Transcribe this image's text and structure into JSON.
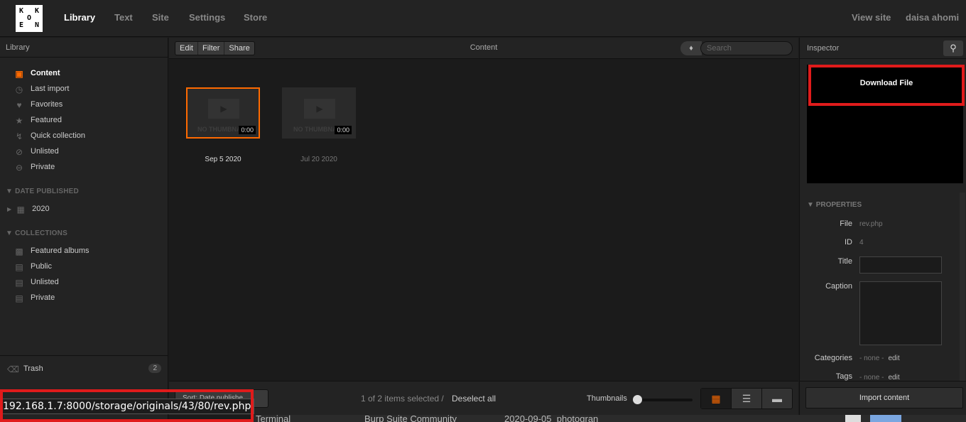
{
  "nav": {
    "logo_letters": [
      "K",
      "O",
      "K",
      "E",
      "N"
    ],
    "items": [
      {
        "label": "Library",
        "active": true
      },
      {
        "label": "Text"
      },
      {
        "label": "Site"
      },
      {
        "label": "Settings"
      },
      {
        "label": "Store"
      }
    ],
    "view_site": "View site",
    "user": "daisa ahomi"
  },
  "sidebar": {
    "title": "Library",
    "items": [
      {
        "label": "Content",
        "icon": "camera-icon",
        "active": true
      },
      {
        "label": "Last import",
        "icon": "clock-icon"
      },
      {
        "label": "Favorites",
        "icon": "heart-icon"
      },
      {
        "label": "Featured",
        "icon": "star-icon"
      },
      {
        "label": "Quick collection",
        "icon": "lightning-icon"
      },
      {
        "label": "Unlisted",
        "icon": "eye-slash-icon"
      },
      {
        "label": "Private",
        "icon": "minus-circle-icon"
      }
    ],
    "date_published_title": "DATE PUBLISHED",
    "year": "2020",
    "collections_title": "COLLECTIONS",
    "collections": [
      {
        "label": "Featured albums",
        "icon": "star-album-icon"
      },
      {
        "label": "Public",
        "icon": "album-icon"
      },
      {
        "label": "Unlisted",
        "icon": "album-icon"
      },
      {
        "label": "Private",
        "icon": "album-icon"
      }
    ],
    "trash_label": "Trash",
    "trash_count": "2"
  },
  "content": {
    "toolbar_buttons": [
      "Edit",
      "Filter",
      "Share"
    ],
    "title": "Content",
    "search_placeholder": "Search",
    "items": [
      {
        "date": "Sep 5 2020",
        "duration": "0:00",
        "placeholder": "NO THUMBNAIL",
        "selected": true
      },
      {
        "date": "Jul 20 2020",
        "duration": "0:00",
        "placeholder": "NO THUMBNAIL",
        "selected": false
      }
    ],
    "sort_label": "Sort: Date publishe",
    "selection_info": "1 of 2 items selected",
    "separator": "/",
    "deselect": "Deselect all",
    "thumbnails_label": "Thumbnails"
  },
  "inspector": {
    "title": "Inspector",
    "download_label": "Download File",
    "properties_title": "PROPERTIES",
    "file_label": "File",
    "file_value": "rev.php",
    "id_label": "ID",
    "id_value": "4",
    "title_label": "Title",
    "caption_label": "Caption",
    "categories_label": "Categories",
    "categories_value": "- none -",
    "tags_label": "Tags",
    "tags_value": "- none -",
    "edit_label": "edit",
    "import_label": "Import content"
  },
  "statusbar": {
    "url": "192.168.1.7:8000/storage/originals/43/80/rev.php"
  },
  "taskbar": {
    "items": [
      "Terminal",
      "Burp Suite Community",
      "2020-09-05_photogran"
    ]
  },
  "colors": {
    "accent": "#ff6a00",
    "highlight_red": "#e01b1b"
  }
}
